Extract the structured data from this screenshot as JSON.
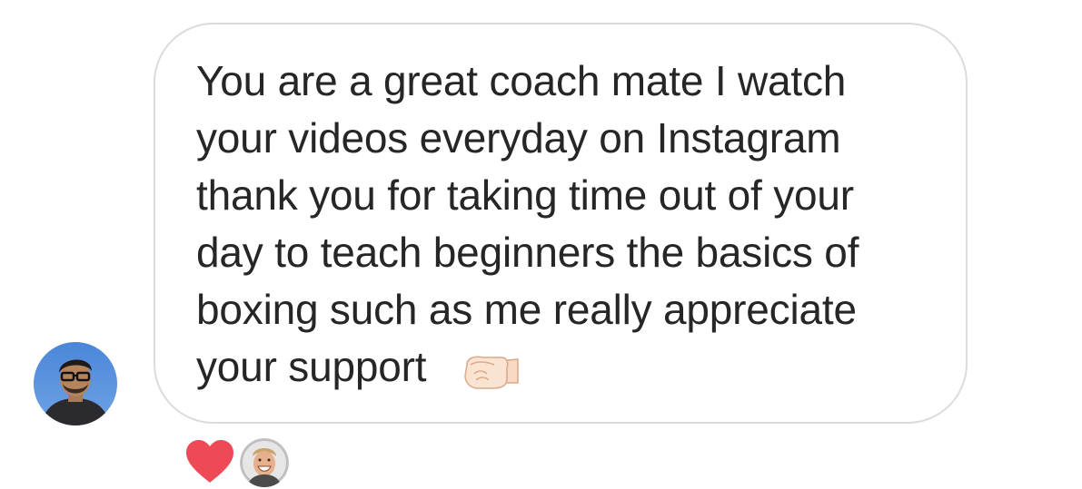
{
  "message": {
    "text": "You are a great coach mate I watch\nyour videos everyday on Instagram\nthank you for taking time out of your\nday to teach beginners the basics of\nboxing such as me really appreciate\nyour support",
    "emoji": "left-facing-fist-emoji"
  },
  "reaction": {
    "icon": "heart-icon",
    "color": "#ed4956"
  },
  "colors": {
    "text": "#262626",
    "bubble_border": "#dbdbdb",
    "background": "#ffffff"
  }
}
